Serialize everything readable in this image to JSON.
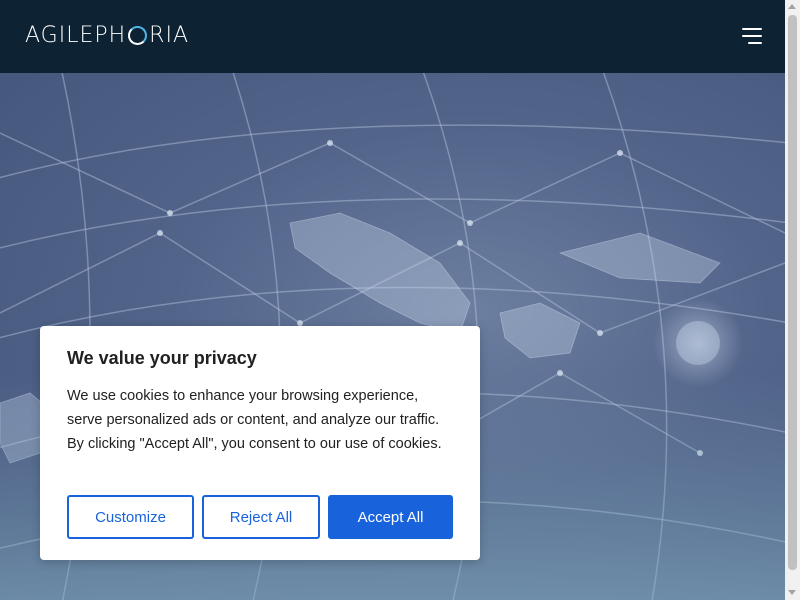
{
  "header": {
    "logo_left": "AGILEPH",
    "logo_right": "RIA",
    "menu_icon": "hamburger-menu-icon"
  },
  "cookie_banner": {
    "title": "We value your privacy",
    "body": "We use cookies to enhance your browsing experience, serve personalized ads or content, and analyze our traffic. By clicking \"Accept All\", you consent to our use of cookies.",
    "customize_label": "Customize",
    "reject_label": "Reject All",
    "accept_label": "Accept All"
  },
  "colors": {
    "header_bg": "#0d2233",
    "accent": "#1863dc",
    "logo_accent": "#4fb6e6"
  }
}
